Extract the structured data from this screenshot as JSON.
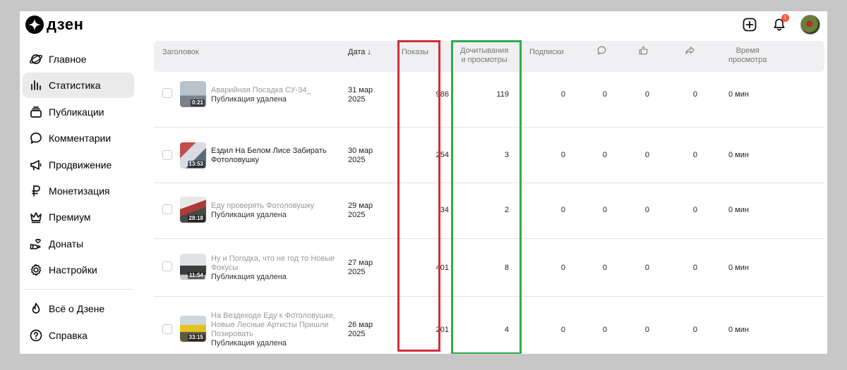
{
  "brand": {
    "name": "дзен"
  },
  "header": {
    "notifications_count": "1"
  },
  "sidebar": {
    "items": [
      {
        "label": "Главное",
        "icon": "planet-icon"
      },
      {
        "label": "Статистика",
        "icon": "bar-chart-icon",
        "active": true
      },
      {
        "label": "Публикации",
        "icon": "stack-icon"
      },
      {
        "label": "Комментарии",
        "icon": "comment-icon"
      },
      {
        "label": "Продвижение",
        "icon": "megaphone-icon"
      },
      {
        "label": "Монетизация",
        "icon": "ruble-icon"
      },
      {
        "label": "Премиум",
        "icon": "crown-icon"
      },
      {
        "label": "Донаты",
        "icon": "donate-hand-icon"
      },
      {
        "label": "Настройки",
        "icon": "gear-icon"
      }
    ],
    "bottom_items": [
      {
        "label": "Всё о Дзене",
        "icon": "flame-icon"
      },
      {
        "label": "Справка",
        "icon": "help-icon"
      }
    ]
  },
  "table": {
    "columns": {
      "title": "Заголовок",
      "date": "Дата",
      "impressions": "Показы",
      "reads_line1": "Дочитывания",
      "reads_line2": "и просмотры",
      "subscriptions": "Подписки",
      "time_line1": "Время",
      "time_line2": "просмотра"
    },
    "rows": [
      {
        "title": "Аварийная Посадка СУ-34_",
        "status": "Публикация удалена",
        "duration": "0:21",
        "date_line1": "31 мар",
        "date_line2": "2025",
        "impressions": "986",
        "reads": "119",
        "subs": "0",
        "comments": "0",
        "likes": "0",
        "shares": "0",
        "time": "0 мин"
      },
      {
        "title": "Ездил На Белом Лисе Забирать Фотоловушку",
        "status": "",
        "duration": "13:53",
        "date_line1": "30 мар",
        "date_line2": "2025",
        "impressions": "254",
        "reads": "3",
        "subs": "0",
        "comments": "0",
        "likes": "0",
        "shares": "0",
        "time": "0 мин"
      },
      {
        "title": "Еду проверять Фотоловушку",
        "status": "Публикация удалена",
        "duration": "28:18",
        "date_line1": "29 мар",
        "date_line2": "2025",
        "impressions": "34",
        "reads": "2",
        "subs": "0",
        "comments": "0",
        "likes": "0",
        "shares": "0",
        "time": "0 мин"
      },
      {
        "title": "Ну и Погодка, что не год то Новые Фокусы",
        "status": "Публикация удалена",
        "duration": "11:54",
        "date_line1": "27 мар",
        "date_line2": "2025",
        "impressions": "401",
        "reads": "8",
        "subs": "0",
        "comments": "0",
        "likes": "0",
        "shares": "0",
        "time": "0 мин"
      },
      {
        "title": "На Вездеходе Еду к Фотоловушке, Новые Лесные Артисты Пришли Позировать",
        "status": "Публикация удалена",
        "duration": "33:15",
        "date_line1": "26 мар",
        "date_line2": "2025",
        "impressions": "201",
        "reads": "4",
        "subs": "0",
        "comments": "0",
        "likes": "0",
        "shares": "0",
        "time": "0 мин"
      }
    ]
  },
  "colors": {
    "highlight_impressions": "#d42d3a",
    "highlight_reads": "#2eac4b",
    "badge": "#ff5a36"
  }
}
